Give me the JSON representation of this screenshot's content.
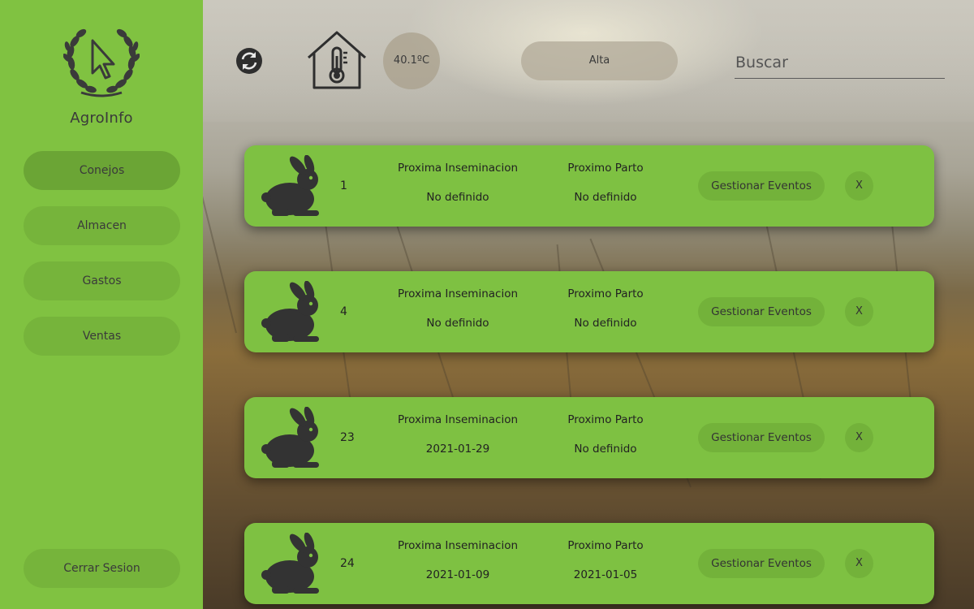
{
  "app": {
    "name": "AgroInfo",
    "accent_color": "#80c241",
    "logo_icon": "laurel-cursor-icon"
  },
  "sidebar": {
    "items": [
      {
        "label": "Conejos",
        "active": true
      },
      {
        "label": "Almacen",
        "active": false
      },
      {
        "label": "Gastos",
        "active": false
      },
      {
        "label": "Ventas",
        "active": false
      }
    ],
    "logout_label": "Cerrar Sesion"
  },
  "topbar": {
    "refresh_icon": "refresh-icon",
    "house_icon": "house-thermometer-icon",
    "temperature": "40.1ºC",
    "level": "Alta",
    "search_placeholder": "Buscar"
  },
  "labels": {
    "insemination": "Proxima Inseminacion",
    "birth": "Proximo Parto",
    "manage": "Gestionar Eventos",
    "delete": "X"
  },
  "rabbits": [
    {
      "id": "1",
      "insemination": "No definido",
      "birth": "No definido"
    },
    {
      "id": "4",
      "insemination": "No definido",
      "birth": "No definido"
    },
    {
      "id": "23",
      "insemination": "2021-01-29",
      "birth": "No definido"
    },
    {
      "id": "24",
      "insemination": "2021-01-09",
      "birth": "2021-01-05"
    }
  ]
}
